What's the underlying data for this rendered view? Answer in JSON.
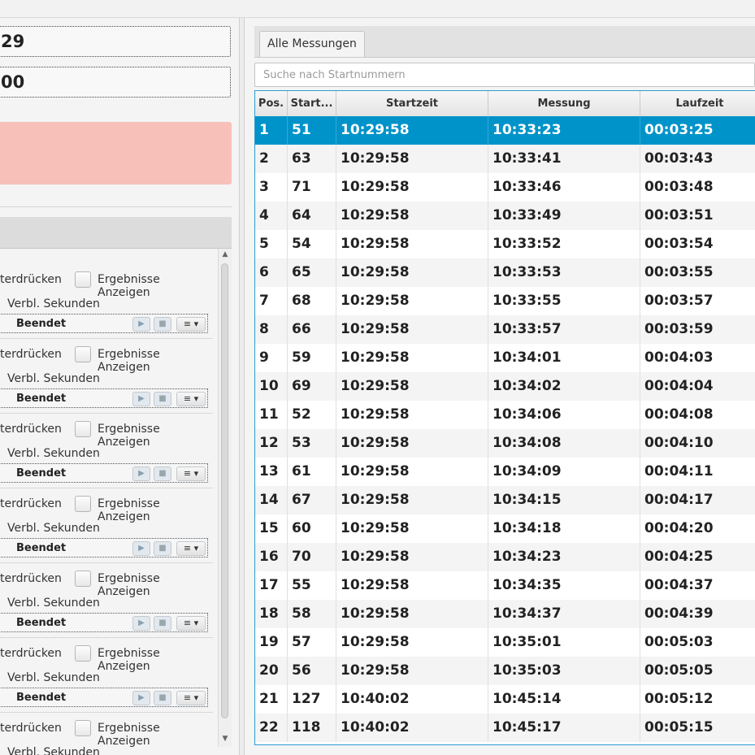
{
  "left": {
    "field1_value": "29",
    "field2_value": "00",
    "entries": [
      {
        "suppress_label": "terdrücken",
        "results_label": "Ergebnisse Anzeigen",
        "remaining_label": "Verbl. Sekunden",
        "status": "Beendet"
      },
      {
        "suppress_label": "terdrücken",
        "results_label": "Ergebnisse Anzeigen",
        "remaining_label": "Verbl. Sekunden",
        "status": "Beendet"
      },
      {
        "suppress_label": "terdrücken",
        "results_label": "Ergebnisse Anzeigen",
        "remaining_label": "Verbl. Sekunden",
        "status": "Beendet"
      },
      {
        "suppress_label": "terdrücken",
        "results_label": "Ergebnisse Anzeigen",
        "remaining_label": "Verbl. Sekunden",
        "status": "Beendet"
      },
      {
        "suppress_label": "terdrücken",
        "results_label": "Ergebnisse Anzeigen",
        "remaining_label": "Verbl. Sekunden",
        "status": "Beendet"
      },
      {
        "suppress_label": "terdrücken",
        "results_label": "Ergebnisse Anzeigen",
        "remaining_label": "Verbl. Sekunden",
        "status": "Beendet"
      },
      {
        "suppress_label": "terdrücken",
        "results_label": "Ergebnisse Anzeigen",
        "remaining_label": "Verbl. Sekunden",
        "status": ""
      }
    ],
    "icons": {
      "play": "play-icon",
      "stop": "stop-icon",
      "menu": "menu-icon"
    }
  },
  "right": {
    "tab_label": "Alle Messungen",
    "search_placeholder": "Suche nach Startnummern",
    "columns": [
      "Pos.",
      "Start...",
      "Startzeit",
      "Messung",
      "Laufzeit"
    ],
    "selected_row": 0,
    "accent_color": "#0093c9",
    "rows": [
      [
        "1",
        "51",
        "10:29:58",
        "10:33:23",
        "00:03:25"
      ],
      [
        "2",
        "63",
        "10:29:58",
        "10:33:41",
        "00:03:43"
      ],
      [
        "3",
        "71",
        "10:29:58",
        "10:33:46",
        "00:03:48"
      ],
      [
        "4",
        "64",
        "10:29:58",
        "10:33:49",
        "00:03:51"
      ],
      [
        "5",
        "54",
        "10:29:58",
        "10:33:52",
        "00:03:54"
      ],
      [
        "6",
        "65",
        "10:29:58",
        "10:33:53",
        "00:03:55"
      ],
      [
        "7",
        "68",
        "10:29:58",
        "10:33:55",
        "00:03:57"
      ],
      [
        "8",
        "66",
        "10:29:58",
        "10:33:57",
        "00:03:59"
      ],
      [
        "9",
        "59",
        "10:29:58",
        "10:34:01",
        "00:04:03"
      ],
      [
        "10",
        "69",
        "10:29:58",
        "10:34:02",
        "00:04:04"
      ],
      [
        "11",
        "52",
        "10:29:58",
        "10:34:06",
        "00:04:08"
      ],
      [
        "12",
        "53",
        "10:29:58",
        "10:34:08",
        "00:04:10"
      ],
      [
        "13",
        "61",
        "10:29:58",
        "10:34:09",
        "00:04:11"
      ],
      [
        "14",
        "67",
        "10:29:58",
        "10:34:15",
        "00:04:17"
      ],
      [
        "15",
        "60",
        "10:29:58",
        "10:34:18",
        "00:04:20"
      ],
      [
        "16",
        "70",
        "10:29:58",
        "10:34:23",
        "00:04:25"
      ],
      [
        "17",
        "55",
        "10:29:58",
        "10:34:35",
        "00:04:37"
      ],
      [
        "18",
        "58",
        "10:29:58",
        "10:34:37",
        "00:04:39"
      ],
      [
        "19",
        "57",
        "10:29:58",
        "10:35:01",
        "00:05:03"
      ],
      [
        "20",
        "56",
        "10:29:58",
        "10:35:03",
        "00:05:05"
      ],
      [
        "21",
        "127",
        "10:40:02",
        "10:45:14",
        "00:05:12"
      ],
      [
        "22",
        "118",
        "10:40:02",
        "10:45:17",
        "00:05:15"
      ]
    ]
  }
}
